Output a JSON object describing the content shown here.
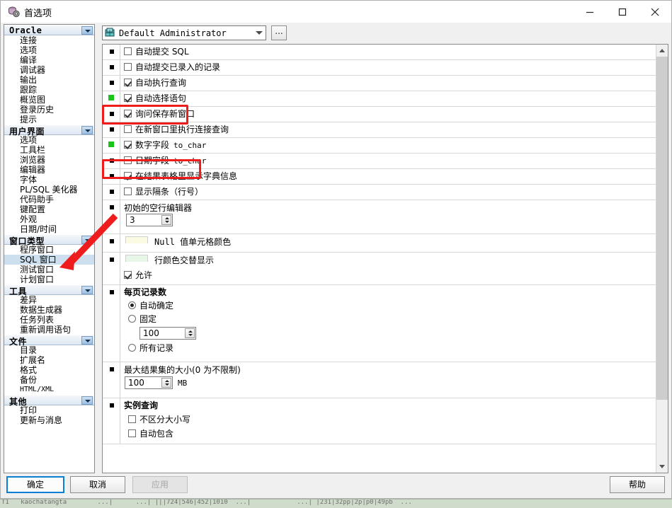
{
  "window": {
    "title": "首选项",
    "icon": "preferences-icon",
    "controls": {
      "minimize": "minimize-icon",
      "maximize": "maximize-icon",
      "close": "close-icon"
    }
  },
  "background_strip": {
    "text": "T1   kaochatangta        ...|      ...| |||724|546|452|1010  ...|            ...| |231|32pp|2p|p0|49pb  ..."
  },
  "sidebar": {
    "groups": [
      {
        "name": "oracle",
        "label": "Oracle",
        "expanded": true,
        "items": [
          "连接",
          "选项",
          "编译",
          "调试器",
          "输出",
          "跟踪",
          "概览图",
          "登录历史",
          "提示"
        ]
      },
      {
        "name": "user-interface",
        "label": "用户界面",
        "expanded": true,
        "items": [
          "选项",
          "工具栏",
          "浏览器",
          "编辑器",
          "字体",
          "PL/SQL 美化器",
          "代码助手",
          "键配置",
          "外观",
          "日期/时间"
        ]
      },
      {
        "name": "window-types",
        "label": "窗口类型",
        "expanded": true,
        "items": [
          "程序窗口",
          "SQL 窗口",
          "测试窗口",
          "计划窗口"
        ],
        "selected": "SQL 窗口"
      },
      {
        "name": "tools",
        "label": "工具",
        "expanded": true,
        "items": [
          "差异",
          "数据生成器",
          "任务列表",
          "重新调用语句"
        ]
      },
      {
        "name": "files",
        "label": "文件",
        "expanded": true,
        "items": [
          "目录",
          "扩展名",
          "格式",
          "备份",
          "HTML/XML"
        ]
      },
      {
        "name": "others",
        "label": "其他",
        "expanded": true,
        "items": [
          "打印",
          "更新与消息"
        ]
      }
    ]
  },
  "profile": {
    "icon": "user-profile-icon",
    "value": "Default Administrator",
    "dropdown_icon": "chevron-down-icon",
    "browse_label": "..."
  },
  "options": [
    {
      "name": "auto-commit-sql",
      "type": "checkbox",
      "label": "自动提交 SQL",
      "checked": false,
      "mono_suffix": ""
    },
    {
      "name": "auto-commit-posted",
      "type": "checkbox",
      "label": "自动提交已录入的记录",
      "checked": false
    },
    {
      "name": "auto-execute-query",
      "type": "checkbox",
      "label": "自动执行查询",
      "checked": true
    },
    {
      "name": "auto-select-statement",
      "type": "checkbox",
      "label": "自动选择语句",
      "checked": true,
      "highlighted": true
    },
    {
      "name": "ask-save-new-window",
      "type": "checkbox",
      "label": "询问保存新窗口",
      "checked": true
    },
    {
      "name": "exec-link-query-new-win",
      "type": "checkbox",
      "label": "在新窗口里执行连接查询",
      "checked": false
    },
    {
      "name": "number-field-to-char",
      "type": "checkbox",
      "label": "数字字段",
      "checked": true,
      "mono_suffix": "to_char",
      "highlighted": true
    },
    {
      "name": "date-field-to-char",
      "type": "checkbox",
      "label": "日期字段",
      "checked": false,
      "mono_suffix": "to_char"
    },
    {
      "name": "show-dict-info-in-grid",
      "type": "checkbox",
      "label": "在结果表格里显示字典信息",
      "checked": true
    },
    {
      "name": "show-gutter-line-numbers",
      "type": "checkbox",
      "label": "显示隔条（行号）",
      "checked": false
    }
  ],
  "blank_editor": {
    "name": "initial-blank-editor",
    "label": "初始的空行编辑器",
    "value": "3"
  },
  "null_color": {
    "name": "null-cell-color",
    "label": "Null 值单元格颜色",
    "swatch": "#fbfbe4"
  },
  "row_alt_color": {
    "name": "row-alternating-color",
    "label": "行颜色交替显示",
    "swatch": "#e8f6e8",
    "enable_label": "允许",
    "enabled": true
  },
  "records_per_page": {
    "name": "records-per-page",
    "title": "每页记录数",
    "options": [
      {
        "name": "auto-determine",
        "label": "自动确定",
        "selected": true
      },
      {
        "name": "fixed",
        "label": "固定",
        "selected": false
      },
      {
        "name": "all-records",
        "label": "所有记录",
        "selected": false
      }
    ],
    "fixed_value": "100"
  },
  "max_result_set": {
    "name": "max-result-set-size",
    "label": "最大结果集的大小(0 为不限制)",
    "value": "100",
    "unit": "MB"
  },
  "instance_query": {
    "name": "instance-query",
    "title": "实例查询",
    "items": [
      {
        "name": "case-insensitive",
        "label": "不区分大小写",
        "checked": false
      },
      {
        "name": "auto-include",
        "label": "自动包含",
        "checked": false
      }
    ]
  },
  "scrollbar": {
    "name": "options-vertical-scrollbar",
    "up_icon": "chevron-up-icon",
    "down_icon": "chevron-down-icon"
  },
  "footer": {
    "ok": "确定",
    "cancel": "取消",
    "apply": "应用",
    "help": "帮助",
    "apply_disabled": true
  },
  "annotations": {
    "highlight_color": "#ee1c1c",
    "marker_color": "#19c519",
    "arrow": {
      "name": "red-arrow-annotation",
      "points_to": "SQL 窗口"
    }
  }
}
